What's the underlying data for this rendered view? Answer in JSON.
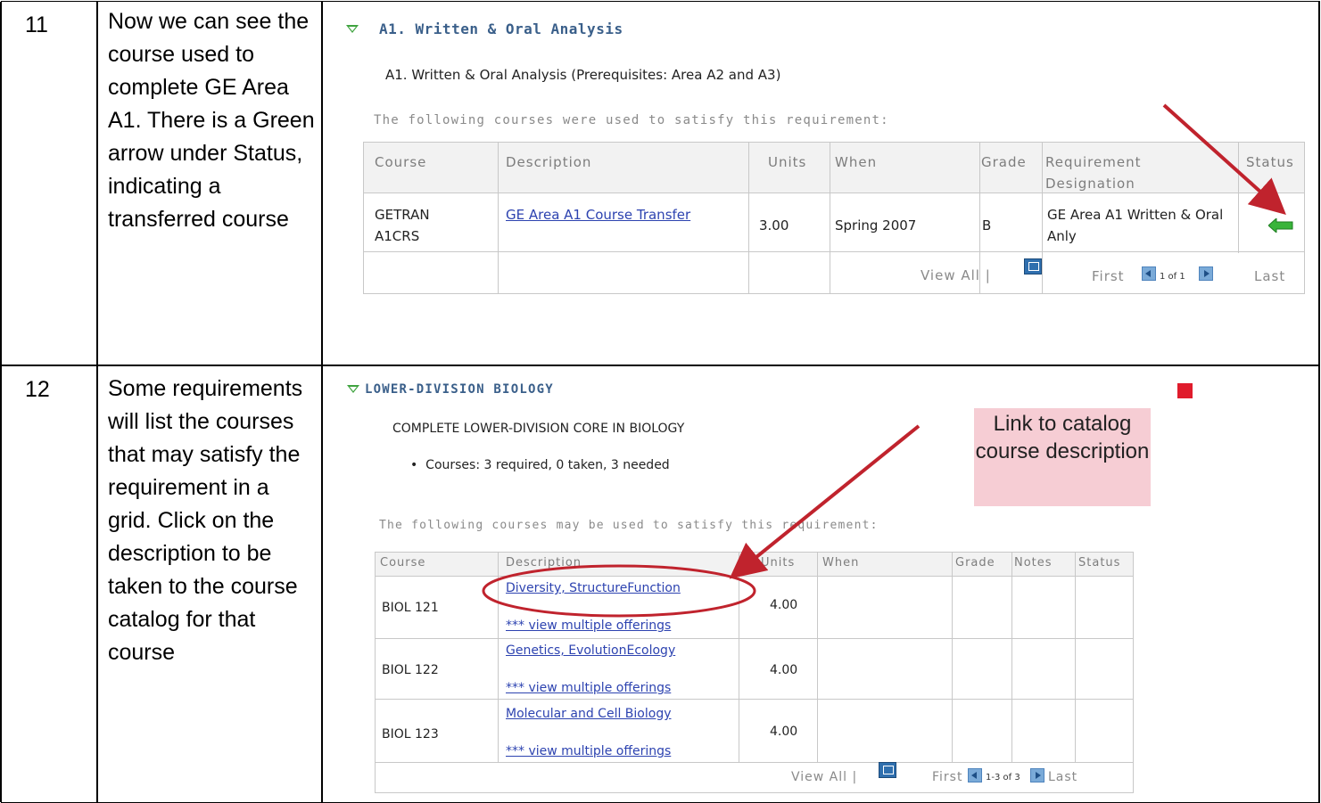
{
  "steps": [
    {
      "number": "11",
      "instruction": "Now we can see the course used to complete GE Area A1. There is a Green arrow under Status, indicating a transferred course",
      "screenshot": {
        "section_title": "A1. Written & Oral Analysis",
        "requirement_title": "A1. Written & Oral Analysis (Prerequisites: Area A2 and A3)",
        "note": "The following courses were used to satisfy this requirement:",
        "columns": [
          "Course",
          "Description",
          "Units",
          "When",
          "Grade",
          "Requirement Designation",
          "Status"
        ],
        "rows": [
          {
            "course": "GETRAN A1CRS",
            "description": "GE Area A1 Course Transfer",
            "units": "3.00",
            "when": "Spring 2007",
            "grade": "B",
            "designation": "GE Area A1 Written & Oral Anly",
            "status_icon": "green-transfer-arrow-icon"
          }
        ],
        "nav": {
          "view_all": "View All |",
          "first": "First",
          "range": "1 of 1",
          "last": "Last"
        }
      }
    },
    {
      "number": "12",
      "instruction": "Some requirements will list the courses that may satisfy the requirement in a grid. Click on the description to be taken to the course catalog for that course",
      "screenshot": {
        "section_title": "LOWER-DIVISION BIOLOGY",
        "requirement_title": "COMPLETE LOWER-DIVISION CORE IN BIOLOGY",
        "bullet": "Courses: 3 required, 0 taken, 3 needed",
        "note": "The following courses may be used to satisfy this requirement:",
        "columns": [
          "Course",
          "Description",
          "Units",
          "When",
          "Grade",
          "Notes",
          "Status"
        ],
        "rows": [
          {
            "course": "BIOL 121",
            "description": "Diversity, StructureFunction",
            "offerings": "*** view multiple offerings",
            "units": "4.00"
          },
          {
            "course": "BIOL 122",
            "description": "Genetics, EvolutionEcology",
            "offerings": "*** view multiple offerings",
            "units": "4.00"
          },
          {
            "course": "BIOL 123",
            "description": "Molecular and Cell Biology",
            "offerings": "*** view multiple offerings",
            "units": "4.00"
          }
        ],
        "nav": {
          "view_all": "View All |",
          "first": "First",
          "range": "1-3 of 3",
          "last": "Last"
        },
        "callout": "Link to catalog course description",
        "colors": {
          "callout_bg": "#f6cdd4",
          "annotation_red": "#c0232d"
        }
      }
    }
  ]
}
